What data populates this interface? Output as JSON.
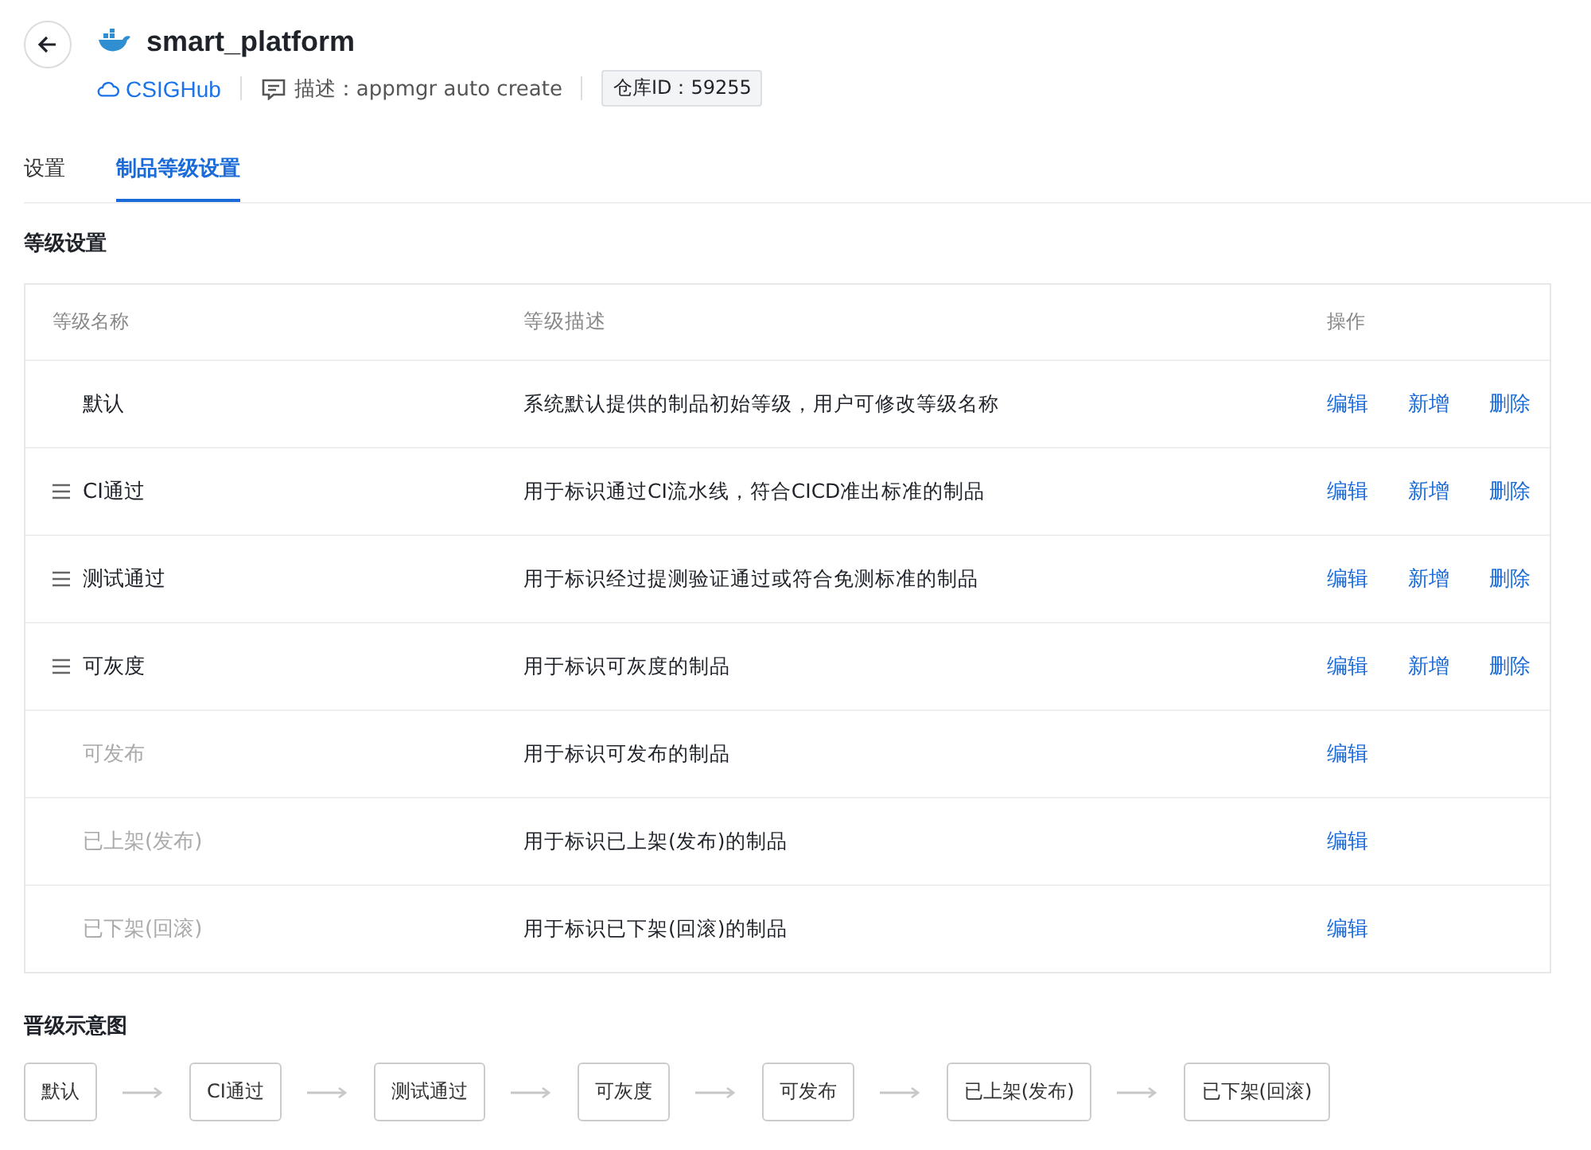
{
  "header": {
    "title": "smart_platform",
    "source": "CSIGHub",
    "description": "描述：appmgr auto create",
    "repo_id": "仓库ID：59255"
  },
  "tabs": [
    {
      "label": "设置",
      "selected": false
    },
    {
      "label": "制品等级设置",
      "selected": true
    }
  ],
  "levels_section": {
    "title": "等级设置",
    "table": {
      "columns": [
        "等级名称",
        "等级描述",
        "操作"
      ],
      "rows": [
        {
          "name": "默认",
          "draggable": false,
          "disabled": false,
          "description": "系统默认提供的制品初始等级，用户可修改等级名称",
          "actions": [
            "编辑",
            "新增",
            "删除"
          ]
        },
        {
          "name": "CI通过",
          "draggable": true,
          "disabled": false,
          "description": "用于标识通过CI流水线，符合CICD准出标准的制品",
          "actions": [
            "编辑",
            "新增",
            "删除"
          ]
        },
        {
          "name": "测试通过",
          "draggable": true,
          "disabled": false,
          "description": "用于标识经过提测验证通过或符合免测标准的制品",
          "actions": [
            "编辑",
            "新增",
            "删除"
          ]
        },
        {
          "name": "可灰度",
          "draggable": true,
          "disabled": false,
          "description": "用于标识可灰度的制品",
          "actions": [
            "编辑",
            "新增",
            "删除"
          ]
        },
        {
          "name": "可发布",
          "draggable": false,
          "disabled": true,
          "description": "用于标识可发布的制品",
          "actions": [
            "编辑"
          ]
        },
        {
          "name": "已上架(发布)",
          "draggable": false,
          "disabled": true,
          "description": "用于标识已上架(发布)的制品",
          "actions": [
            "编辑"
          ]
        },
        {
          "name": "已下架(回滚)",
          "draggable": false,
          "disabled": true,
          "description": "用于标识已下架(回滚)的制品",
          "actions": [
            "编辑"
          ]
        }
      ]
    }
  },
  "diagram_section": {
    "title": "晋级示意图",
    "steps": [
      "默认",
      "CI通过",
      "测试通过",
      "可灰度",
      "可发布",
      "已上架(发布)",
      "已下架(回滚)"
    ]
  }
}
